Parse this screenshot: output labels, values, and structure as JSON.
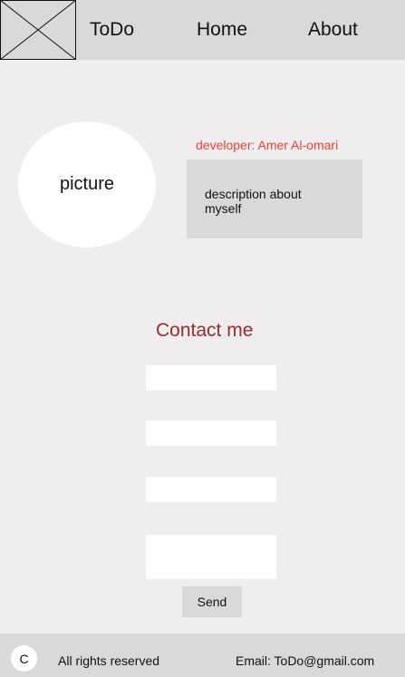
{
  "nav": {
    "brand": "ToDo",
    "links": [
      {
        "label": "Home"
      },
      {
        "label": "About"
      }
    ]
  },
  "profile": {
    "picture_label": "picture",
    "developer": "developer: Amer Al-omari",
    "description": "description about myself"
  },
  "contact": {
    "title": "Contact me",
    "send_label": "Send"
  },
  "footer": {
    "copyright_symbol": "C",
    "rights": "All rights reserved",
    "email": "Email: ToDo@gmail.com"
  },
  "colors": {
    "developer_text": "#e8423a",
    "contact_title": "#9b2c2c",
    "panel": "#d9d9d9",
    "background": "#efeded"
  },
  "icons": {
    "logo": "image-placeholder-icon"
  }
}
